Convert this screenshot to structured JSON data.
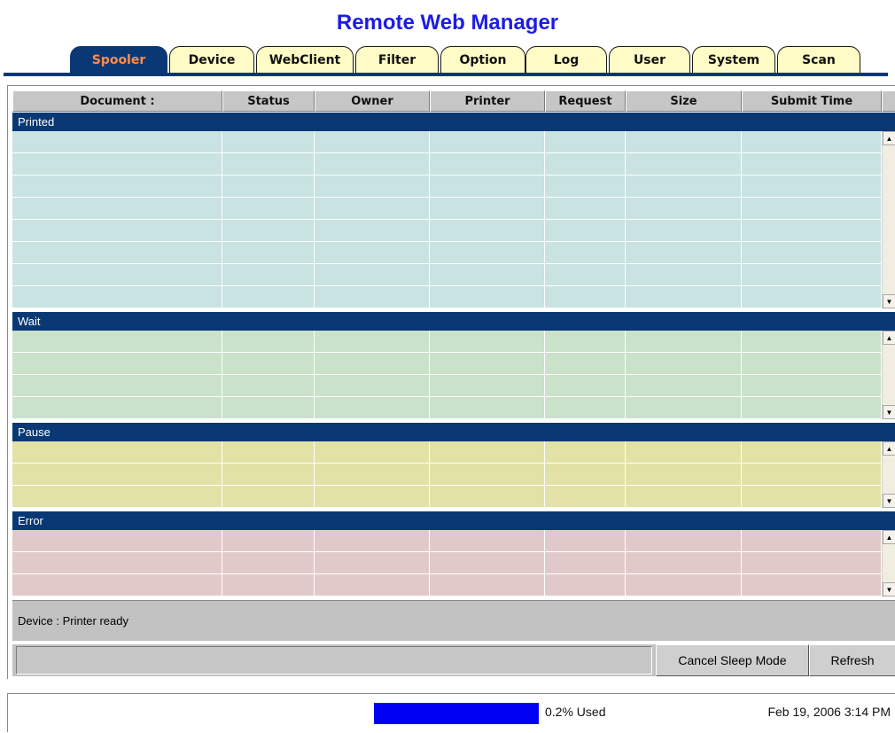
{
  "app": {
    "title": "Remote Web Manager"
  },
  "tabs": [
    {
      "label": "Spooler",
      "active": true
    },
    {
      "label": "Device",
      "active": false
    },
    {
      "label": "WebClient",
      "active": false
    },
    {
      "label": "Filter",
      "active": false
    },
    {
      "label": "Option",
      "active": false
    },
    {
      "label": "Log",
      "active": false
    },
    {
      "label": "User",
      "active": false
    },
    {
      "label": "System",
      "active": false
    },
    {
      "label": "Scan",
      "active": false
    }
  ],
  "table": {
    "columns": [
      "Document :",
      "Status",
      "Owner",
      "Printer",
      "Request",
      "Size",
      "Submit Time"
    ],
    "sections": [
      {
        "label": "Printed",
        "color": "#c9e2e2",
        "rows": 8
      },
      {
        "label": "Wait",
        "color": "#c9e2c9",
        "rows": 4
      },
      {
        "label": "Pause",
        "color": "#e2e2a6",
        "rows": 3
      },
      {
        "label": "Error",
        "color": "#e2c9c9",
        "rows": 3
      }
    ]
  },
  "status": {
    "device_text": "Device : Printer ready",
    "cancel_sleep_label": "Cancel Sleep Mode",
    "refresh_label": "Refresh"
  },
  "footer": {
    "usage_text": "0.2% Used",
    "usage_fraction": 0.002,
    "datetime": "Feb 19, 2006 3:14 PM"
  },
  "colors": {
    "title": "#1c1ce6",
    "tab_bg": "#fefbc6",
    "tab_active_bg": "#0a3874",
    "tab_active_text": "#ff8c4a",
    "section_head": "#0a3874",
    "usage_bar": "#0000f5"
  }
}
